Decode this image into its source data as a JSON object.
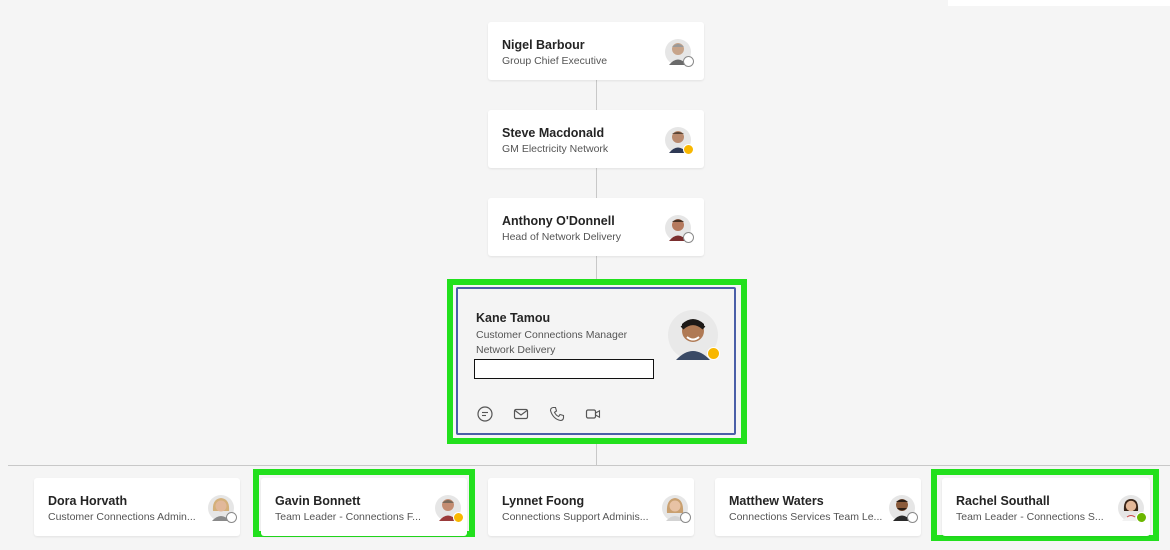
{
  "chain": [
    {
      "name": "Nigel Barbour",
      "title": "Group Chief Executive",
      "presence": "offline"
    },
    {
      "name": "Steve Macdonald",
      "title": "GM Electricity Network",
      "presence": "away"
    },
    {
      "name": "Anthony O'Donnell",
      "title": "Head of Network Delivery",
      "presence": "offline"
    }
  ],
  "focus": {
    "name": "Kane Tamou",
    "title": "Customer Connections Manager",
    "department": "Network Delivery",
    "presence": "away",
    "actions": [
      "chat-icon",
      "mail-icon",
      "phone-icon",
      "video-icon"
    ]
  },
  "reports": [
    {
      "name": "Dora Horvath",
      "title": "Customer Connections Admin...",
      "presence": "offline",
      "highlighted": false
    },
    {
      "name": "Gavin Bonnett",
      "title": "Team Leader - Connections F...",
      "presence": "away",
      "highlighted": true
    },
    {
      "name": "Lynnet Foong",
      "title": "Connections Support Adminis...",
      "presence": "offline",
      "highlighted": false
    },
    {
      "name": "Matthew Waters",
      "title": "Connections Services Team Le...",
      "presence": "offline",
      "highlighted": false
    },
    {
      "name": "Rachel Southall",
      "title": "Team Leader - Connections S...",
      "presence": "available",
      "highlighted": true
    }
  ],
  "colors": {
    "highlight": "#22e01d",
    "focus_border": "#4a5fa8",
    "away": "#f8b700",
    "available": "#6bb700"
  }
}
